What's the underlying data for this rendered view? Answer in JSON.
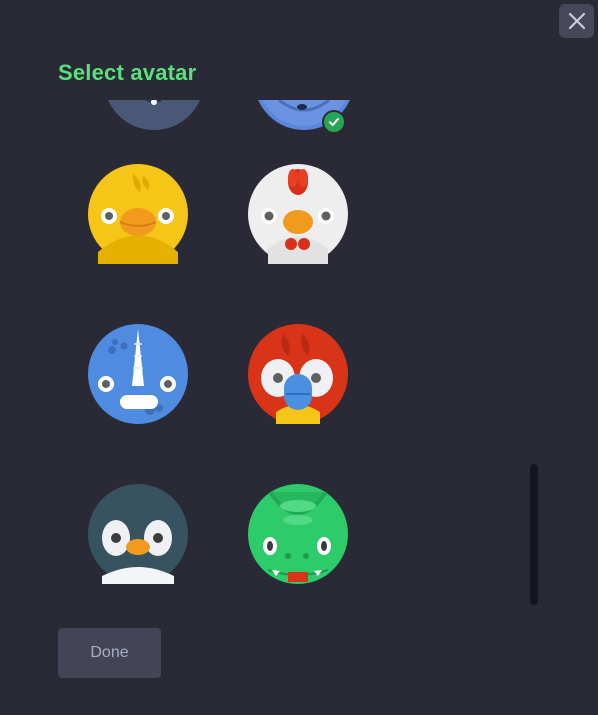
{
  "dialog": {
    "title": "Select avatar",
    "done_label": "Done",
    "accent_color": "#59e07a"
  },
  "close_button": {
    "icon": "close-icon"
  },
  "avatars": [
    {
      "name": "owl",
      "color": "#3f4b6a",
      "selected": false
    },
    {
      "name": "monster",
      "color": "#5c86d9",
      "selected": true
    },
    {
      "name": "duck",
      "color": "#f5c518",
      "selected": false
    },
    {
      "name": "chicken",
      "color": "#eeeeee",
      "selected": false
    },
    {
      "name": "rhino",
      "color": "#4f8ce0",
      "selected": false
    },
    {
      "name": "parrot",
      "color": "#d93418",
      "selected": false
    },
    {
      "name": "penguin",
      "color": "#37535f",
      "selected": false
    },
    {
      "name": "dinosaur",
      "color": "#2ecb6a",
      "selected": false
    }
  ],
  "selected_indicator": {
    "icon": "check-icon",
    "color": "#26a654"
  }
}
